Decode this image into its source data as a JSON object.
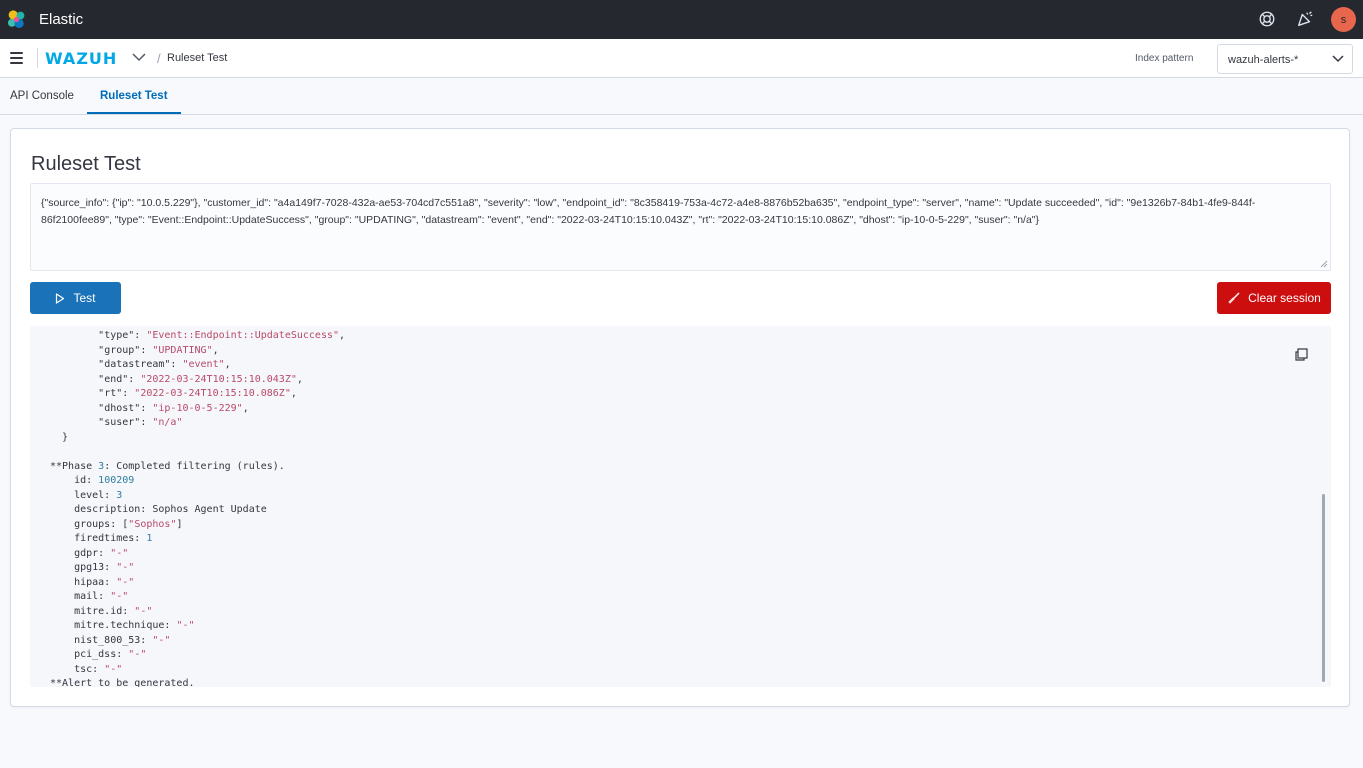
{
  "topbar": {
    "title": "Elastic",
    "icons": [
      "help-icon",
      "newsfeed-icon"
    ],
    "avatar_initial": "s",
    "avatar_color": "#e7664c"
  },
  "header": {
    "logo_text": "WAZUH",
    "breadcrumb_separator": "/",
    "breadcrumb_current": "Ruleset Test",
    "index_pattern_label": "Index pattern",
    "index_pattern_value": "wazuh-alerts-*"
  },
  "tabs": [
    {
      "label": "API Console",
      "active": false
    },
    {
      "label": "Ruleset Test",
      "active": true
    }
  ],
  "panel": {
    "title": "Ruleset Test",
    "log_input": "{\"source_info\": {\"ip\": \"10.0.5.229\"}, \"customer_id\": \"a4a149f7-7028-432a-ae53-704cd7c551a8\", \"severity\": \"low\", \"endpoint_id\": \"8c358419-753a-4c72-a4e8-8876b52ba635\", \"endpoint_type\": \"server\", \"name\": \"Update succeeded\", \"id\": \"9e1326b7-84b1-4fe9-844f-86f2100fee89\", \"type\": \"Event::Endpoint::UpdateSuccess\", \"group\": \"UPDATING\", \"datastream\": \"event\", \"end\": \"2022-03-24T10:15:10.043Z\", \"rt\": \"2022-03-24T10:15:10.086Z\", \"dhost\": \"ip-10-0-5-229\", \"suser\": \"n/a\"}",
    "test_label": "Test",
    "clear_label": "Clear session"
  },
  "output": {
    "fields": [
      {
        "key": "type",
        "value": "Event::Endpoint::UpdateSuccess"
      },
      {
        "key": "group",
        "value": "UPDATING"
      },
      {
        "key": "datastream",
        "value": "event"
      },
      {
        "key": "end",
        "value": "2022-03-24T10:15:10.043Z"
      },
      {
        "key": "rt",
        "value": "2022-03-24T10:15:10.086Z"
      },
      {
        "key": "dhost",
        "value": "ip-10-0-5-229"
      },
      {
        "key": "suser",
        "value": "n/a"
      }
    ],
    "phase3_prefix": "**Phase ",
    "phase3_num": "3",
    "phase3_suffix": ": Completed filtering (rules).",
    "id": "100209",
    "level": "3",
    "description": "Sophos Agent Update",
    "groups": "Sophos",
    "firedtimes": "1",
    "gdpr": "-",
    "gpg13": "-",
    "hipaa": "-",
    "mail": "-",
    "mitre_id": "-",
    "mitre_technique": "-",
    "nist_800_53": "-",
    "pci_dss": "-",
    "tsc": "-",
    "alert_line": "**Alert to be generated."
  },
  "colors": {
    "primary": "#1a73b8",
    "danger": "#cc0e0e",
    "topbar": "#25282f"
  }
}
